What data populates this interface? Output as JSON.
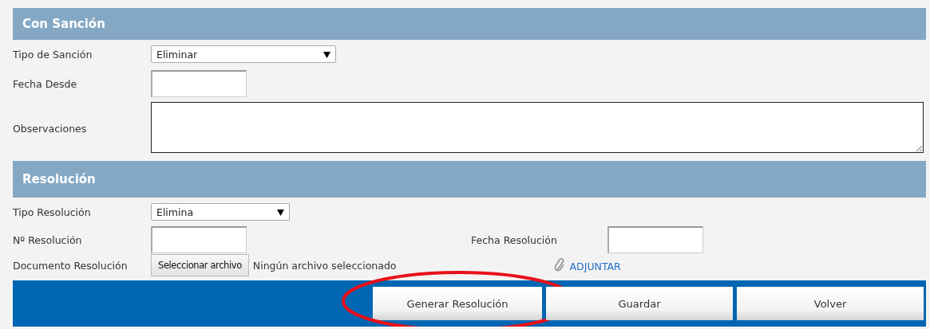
{
  "sanction": {
    "title": "Con Sanción",
    "type_label": "Tipo de Sanción",
    "type_value": "Eliminar",
    "date_label": "Fecha Desde",
    "notes_label": "Observaciones"
  },
  "resolution": {
    "title": "Resolución",
    "type_label": "Tipo Resolución",
    "type_value": "Elimina",
    "number_label": "Nº Resolución",
    "date_label": "Fecha Resolución",
    "document_label": "Documento Resolución",
    "file_button": "Seleccionar archivo",
    "file_status": "Ningún archivo seleccionado",
    "attach_link": "ADJUNTAR"
  },
  "actions": [
    {
      "label": "Generar Resolución",
      "highlighted": true
    },
    {
      "label": "Guardar",
      "highlighted": false
    },
    {
      "label": "Volver",
      "highlighted": false
    }
  ]
}
